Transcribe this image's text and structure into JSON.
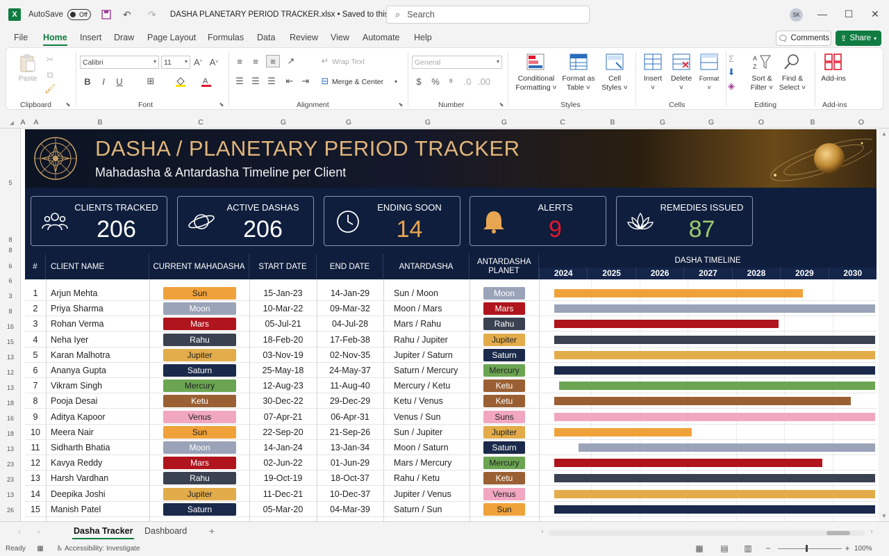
{
  "titlebar": {
    "app_logo": "X",
    "autosave_label": "AutoSave",
    "autosave_state": "Off",
    "doc_title": "DASHA PLANETARY PERIOD TRACKER.xlsx • Saved to this PC ˅",
    "search_placeholder": "Search",
    "avatar_initials": "SK"
  },
  "menu": {
    "tabs": [
      "File",
      "Home",
      "Insert",
      "Draw",
      "Page Layout",
      "Formulas",
      "Data",
      "Review",
      "View",
      "Automate",
      "Help"
    ],
    "active": "Home",
    "comments_label": "Comments",
    "share_label": "Share"
  },
  "ribbon": {
    "clipboard": {
      "paste": "Paste",
      "group": "Clipboard"
    },
    "font": {
      "name": "Calibri",
      "size": "11",
      "group": "Font"
    },
    "alignment": {
      "wrap": "Wrap Text",
      "merge": "Merge & Center",
      "group": "Alignment"
    },
    "number": {
      "format": "General",
      "group": "Number"
    },
    "styles": {
      "conditional": "Conditional",
      "conditional2": "Formatting",
      "format_as": "Format as",
      "format_as2": "Table",
      "cell": "Cell",
      "cell2": "Styles",
      "group": "Styles"
    },
    "cells": {
      "insert": "Insert",
      "delete": "Delete",
      "format": "Format",
      "group": "Cells"
    },
    "editing": {
      "sort": "Sort &",
      "sort2": "Filter",
      "find": "Find &",
      "find2": "Select",
      "group": "Editing"
    },
    "addins": {
      "label": "Add-ins",
      "group": "Add-ins"
    }
  },
  "columns": [
    "A",
    "B",
    "C",
    "G",
    "G",
    "G",
    "G",
    "C",
    "B",
    "G",
    "G",
    "O",
    "B",
    "O"
  ],
  "row_numbers": [
    "5",
    "8",
    "8",
    "6",
    "6",
    "3",
    "8",
    "16",
    "15",
    "13",
    "12",
    "13",
    "18",
    "16",
    "18",
    "13",
    "23",
    "23",
    "13",
    "26"
  ],
  "banner": {
    "title": "DASHA / PLANETARY PERIOD TRACKER",
    "subtitle": "Mahadasha & Antardasha Timeline per Client"
  },
  "kpis": [
    {
      "label": "CLIENTS TRACKED",
      "value": "206",
      "color": "#ffffff",
      "icon": "people-icon"
    },
    {
      "label": "ACTIVE DASHAS",
      "value": "206",
      "color": "#ffffff",
      "icon": "planet-icon"
    },
    {
      "label": "ENDING SOON",
      "value": "14",
      "color": "#e8a652",
      "icon": "clock-icon"
    },
    {
      "label": "ALERTS",
      "value": "9",
      "color": "#e0182d",
      "icon": "bell-icon"
    },
    {
      "label": "REMEDIES ISSUED",
      "value": "87",
      "color": "#9ccb6e",
      "icon": "lotus-icon"
    }
  ],
  "table": {
    "headers": [
      "#",
      "CLIENT NAME",
      "CURRENT MAHADASHA",
      "START DATE",
      "END DATE",
      "ANTARDASHA",
      "ANTARDASHA PLANET"
    ],
    "timeline_title": "DASHA TIMELINE",
    "years": [
      "2024",
      "2025",
      "2026",
      "2027",
      "2028",
      "2029",
      "2030"
    ],
    "rows": [
      {
        "n": "1",
        "name": "Arjun Mehta",
        "maha": "Sun",
        "start": "15-Jan-23",
        "end": "14-Jan-29",
        "antar": "Sun / Moon",
        "aplanet": "Moon",
        "bar": [
          2023.0,
          2029.0
        ]
      },
      {
        "n": "2",
        "name": "Priya Sharma",
        "maha": "Moon",
        "start": "10-Mar-22",
        "end": "09-Mar-32",
        "antar": "Moon / Mars",
        "aplanet": "Mars",
        "bar": [
          2022.2,
          2032.2
        ]
      },
      {
        "n": "3",
        "name": "Rohan Verma",
        "maha": "Mars",
        "start": "05-Jul-21",
        "end": "04-Jul-28",
        "antar": "Mars / Rahu",
        "aplanet": "Rahu",
        "bar": [
          2021.5,
          2028.5
        ]
      },
      {
        "n": "4",
        "name": "Neha Iyer",
        "maha": "Rahu",
        "start": "18-Feb-20",
        "end": "17-Feb-38",
        "antar": "Rahu / Jupiter",
        "aplanet": "Jupiter",
        "bar": [
          2020.1,
          2038.1
        ]
      },
      {
        "n": "5",
        "name": "Karan Malhotra",
        "maha": "Jupiter",
        "start": "03-Nov-19",
        "end": "02-Nov-35",
        "antar": "Jupiter / Saturn",
        "aplanet": "Saturn",
        "bar": [
          2019.8,
          2035.8
        ]
      },
      {
        "n": "6",
        "name": "Ananya Gupta",
        "maha": "Saturn",
        "start": "25-May-18",
        "end": "24-May-37",
        "antar": "Saturn / Mercury",
        "aplanet": "Mercury",
        "bar": [
          2018.4,
          2037.4
        ]
      },
      {
        "n": "7",
        "name": "Vikram Singh",
        "maha": "Mercury",
        "start": "12-Aug-23",
        "end": "11-Aug-40",
        "antar": "Mercury / Ketu",
        "aplanet": "Ketu",
        "bar": [
          2023.6,
          2040.6
        ]
      },
      {
        "n": "8",
        "name": "Pooja Desai",
        "maha": "Ketu",
        "start": "30-Dec-22",
        "end": "29-Dec-29",
        "antar": "Ketu / Venus",
        "aplanet": "Ketu",
        "bar": [
          2023.0,
          2030.0
        ]
      },
      {
        "n": "9",
        "name": "Aditya Kapoor",
        "maha": "Venus",
        "start": "07-Apr-21",
        "end": "06-Apr-31",
        "antar": "Venus / Sun",
        "aplanet": "Suns",
        "bar": [
          2021.3,
          2031.3
        ]
      },
      {
        "n": "10",
        "name": "Meera Nair",
        "maha": "Sun",
        "start": "22-Sep-20",
        "end": "21-Sep-26",
        "antar": "Sun / Jupiter",
        "aplanet": "Jupiter",
        "bar": [
          2020.7,
          2026.7
        ]
      },
      {
        "n": "11",
        "name": "Sidharth Bhatia",
        "maha": "Moon",
        "start": "14-Jan-24",
        "end": "13-Jan-34",
        "antar": "Moon / Saturn",
        "aplanet": "Saturn",
        "bar": [
          2024.0,
          2034.0
        ]
      },
      {
        "n": "12",
        "name": "Kavya Reddy",
        "maha": "Mars",
        "start": "02-Jun-22",
        "end": "01-Jun-29",
        "antar": "Mars / Mercury",
        "aplanet": "Mercury",
        "bar": [
          2022.4,
          2029.4
        ]
      },
      {
        "n": "13",
        "name": "Harsh Vardhan",
        "maha": "Rahu",
        "start": "19-Oct-19",
        "end": "18-Oct-37",
        "antar": "Rahu / Ketu",
        "aplanet": "Ketu",
        "bar": [
          2019.8,
          2037.8
        ]
      },
      {
        "n": "14",
        "name": "Deepika Joshi",
        "maha": "Jupiter",
        "start": "11-Dec-21",
        "end": "10-Dec-37",
        "antar": "Jupiter / Venus",
        "aplanet": "Venus",
        "bar": [
          2021.9,
          2037.9
        ]
      },
      {
        "n": "15",
        "name": "Manish Patel",
        "maha": "Saturn",
        "start": "05-Mar-20",
        "end": "04-Mar-39",
        "antar": "Saturn / Sun",
        "aplanet": "Sun",
        "bar": [
          2020.2,
          2039.2
        ]
      }
    ]
  },
  "planet_colors": {
    "Sun": "#f0a23a",
    "Moon": "#9aa3b8",
    "Mars": "#b0141d",
    "Rahu": "#3a4150",
    "Jupiter": "#e3ac4a",
    "Saturn": "#1b2a4a",
    "Mercury": "#6ba552",
    "Ketu": "#9a6034",
    "Venus": "#f2a7c0",
    "Suns": "#f2a7c0"
  },
  "sheet_tabs": [
    "Dasha Tracker",
    "Dashboard"
  ],
  "active_sheet": "Dasha Tracker",
  "status": {
    "ready": "Ready",
    "accessibility": "Accessibility: Investigate",
    "zoom": "100%"
  }
}
